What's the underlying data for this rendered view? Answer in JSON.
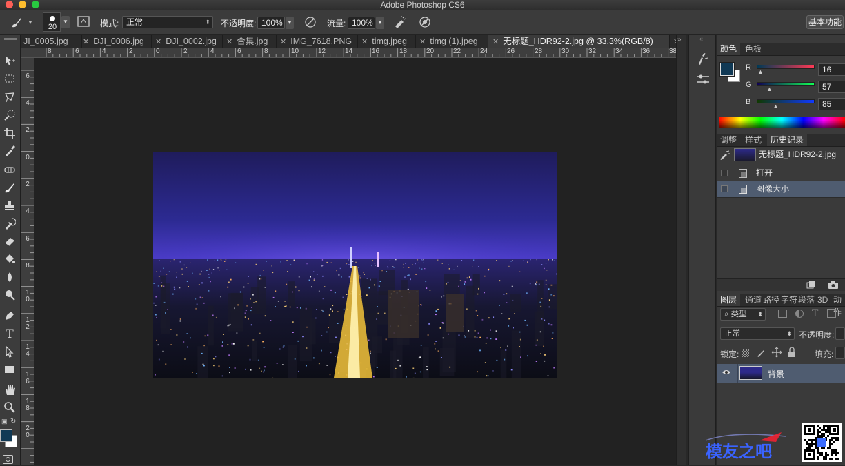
{
  "app": {
    "title": "Adobe Photoshop CS6"
  },
  "options_bar": {
    "brush_size": "20",
    "mode_label": "模式:",
    "mode_value": "正常",
    "opacity_label": "不透明度:",
    "opacity_value": "100%",
    "flow_label": "流量:",
    "flow_value": "100%",
    "workspace_button": "基本功能"
  },
  "tabs": [
    {
      "label": "JI_0005.jpg",
      "active": false
    },
    {
      "label": "DJI_0006.jpg",
      "active": false
    },
    {
      "label": "DJI_0002.jpg",
      "active": false
    },
    {
      "label": "合集.jpg",
      "active": false
    },
    {
      "label": "IMG_7618.PNG",
      "active": false
    },
    {
      "label": "timg.jpeg",
      "active": false
    },
    {
      "label": "timg (1).jpeg",
      "active": false
    },
    {
      "label": "无标题_HDR92-2.jpg @ 33.3%(RGB/8)",
      "active": true
    }
  ],
  "tabs_overflow": ">>",
  "ruler_top_labels": [
    "8",
    "6",
    "4",
    "2",
    "0",
    "2",
    "4",
    "6",
    "8",
    "10",
    "12",
    "14",
    "16",
    "18",
    "20",
    "22",
    "24",
    "26",
    "28",
    "30",
    "32",
    "34",
    "36",
    "38"
  ],
  "ruler_left_labels": [
    "6",
    "4",
    "2",
    "0",
    "2",
    "4",
    "6",
    "8",
    "10",
    "12",
    "14",
    "16",
    "18",
    "20"
  ],
  "color_panel": {
    "tabs": [
      "颜色",
      "色板"
    ],
    "r_label": "R",
    "r_value": "16",
    "g_label": "G",
    "g_value": "57",
    "b_label": "B",
    "b_value": "85",
    "foreground": "#103955",
    "background": "#ffffff"
  },
  "history_panel": {
    "tabs": [
      "调整",
      "样式",
      "历史记录"
    ],
    "snapshot": "无标题_HDR92-2.jpg",
    "steps": [
      "打开",
      "图像大小"
    ]
  },
  "layers_panel": {
    "tabs": [
      "图层",
      "通道",
      "路径",
      "字符",
      "段落",
      "3D",
      "动作"
    ],
    "filter_label": "类型",
    "blend_mode": "正常",
    "opacity_label": "不透明度:",
    "lock_label": "锁定:",
    "fill_label": "填充:",
    "layer_name": "背景"
  },
  "toolbox": {
    "foreground": "#103955",
    "background": "#ffffff"
  },
  "watermark": {
    "text": "模友之吧"
  },
  "icons": [
    "brush-icon",
    "brush-panel-icon",
    "airbrush-icon",
    "pressure-icon",
    "move-icon",
    "marquee-icon",
    "lasso-icon",
    "quick-select-icon",
    "crop-icon",
    "eyedropper-icon",
    "healing-icon",
    "brush-tool-icon",
    "stamp-icon",
    "history-brush-icon",
    "eraser-icon",
    "bucket-icon",
    "blur-icon",
    "dodge-icon",
    "pen-icon",
    "type-icon",
    "path-select-icon",
    "rectangle-icon",
    "hand-icon",
    "zoom-icon",
    "eye-icon",
    "new-snapshot-icon",
    "camera-icon"
  ]
}
